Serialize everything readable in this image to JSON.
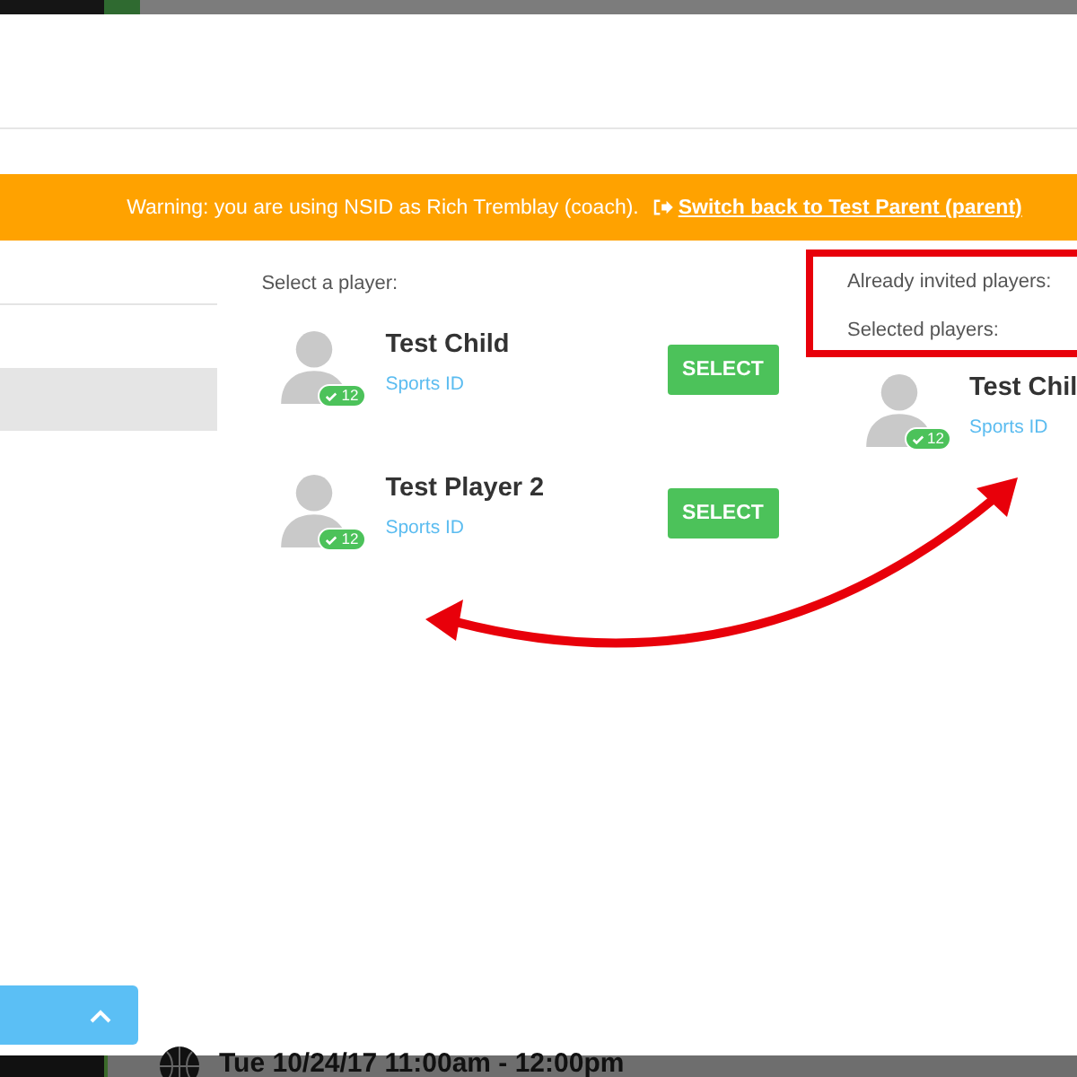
{
  "banner": {
    "message": "Warning: you are using NSID as Rich Tremblay (coach).",
    "link": "Switch back to Test Parent (parent)"
  },
  "select_section": {
    "heading": "Select a player:",
    "players": [
      {
        "name": "Test Child",
        "badge": "12",
        "link": "Sports ID",
        "button": "SELECT"
      },
      {
        "name": "Test Player 2",
        "badge": "12",
        "link": "Sports ID",
        "button": "SELECT"
      }
    ]
  },
  "invited_section": {
    "heading": "Already invited players:"
  },
  "selected_section": {
    "heading": "Selected players:",
    "players": [
      {
        "name": "Test Chil",
        "badge": "12",
        "link": "Sports ID"
      }
    ]
  },
  "event_strip": {
    "text": "Tue 10/24/17 11:00am - 12:00pm"
  }
}
